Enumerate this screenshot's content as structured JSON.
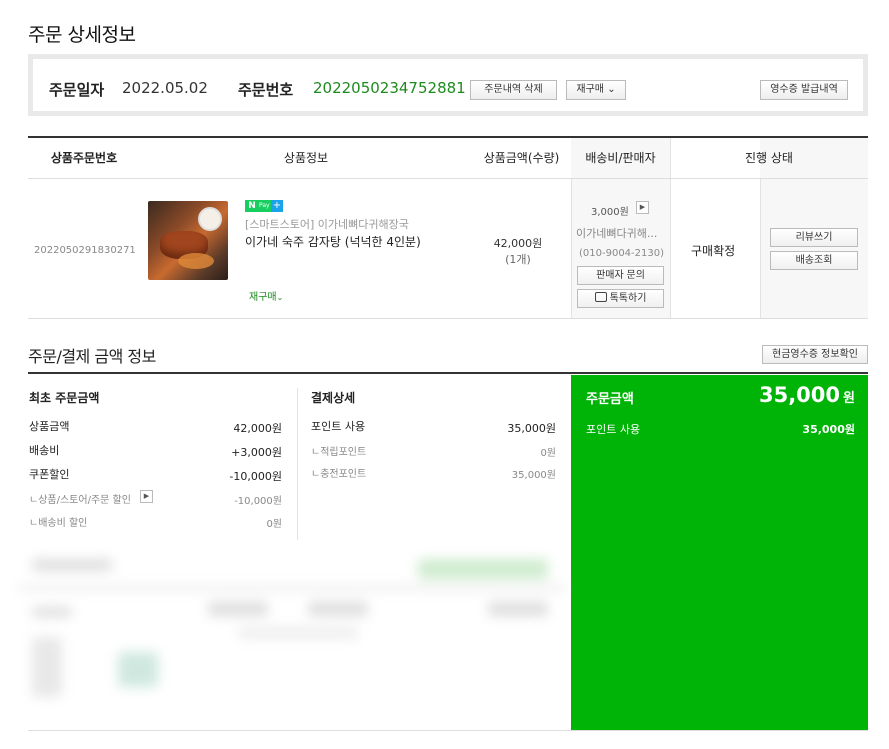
{
  "page": {
    "title": "주문 상세정보"
  },
  "summary": {
    "date_label": "주문일자",
    "date_value": "2022.05.02",
    "number_label": "주문번호",
    "number_value": "2022050234752881",
    "delete_btn": "주문내역 삭제",
    "rebuy_btn": "재구매",
    "receipt_btn": "영수증 발급내역"
  },
  "table": {
    "headers": [
      "상품주문번호",
      "상품정보",
      "상품금액(수량)",
      "배송비/판매자",
      "진행 상태"
    ],
    "row": {
      "order_no": "2022050291830271",
      "badge_n": "N",
      "badge_pay": "Pay",
      "badge_plus": "+",
      "store": "[스마트스토어] 이가네뼈다귀해장국",
      "product": "이가네 숙주 감자탕 (넉넉한 4인분)",
      "rebuy": "재구매",
      "price": "42,000원",
      "qty": "(1개)",
      "ship_fee": "3,000원",
      "seller": "이가네뼈다귀해...",
      "seller_tel": "(010-9004-2130)",
      "inquiry_btn": "판매자 문의",
      "talk_btn": "톡톡하기",
      "status": "구매확정",
      "review_btn": "리뷰쓰기",
      "track_btn": "배송조회"
    }
  },
  "payment": {
    "title": "주문/결제 금액 정보",
    "cash_receipt_btn": "현금영수증 정보확인",
    "initial": {
      "heading": "최초 주문금액",
      "rows": [
        {
          "label": "상품금액",
          "value": "42,000원"
        },
        {
          "label": "배송비",
          "value": "+3,000원"
        },
        {
          "label": "쿠폰할인",
          "value": "-10,000원"
        }
      ],
      "sub_rows": [
        {
          "label": "ㄴ상품/스토어/주문 할인",
          "value": "-10,000원"
        },
        {
          "label": "ㄴ배송비 할인",
          "value": "0원"
        }
      ]
    },
    "detail": {
      "heading": "결제상세",
      "rows": [
        {
          "label": "포인트 사용",
          "value": "35,000원"
        }
      ],
      "sub_rows": [
        {
          "label": "ㄴ적립포인트",
          "value": "0원"
        },
        {
          "label": "ㄴ충전포인트",
          "value": "35,000원"
        }
      ]
    },
    "total": {
      "label": "주문금액",
      "amount": "35,000",
      "unit": "원",
      "sub_label": "포인트 사용",
      "sub_value": "35,000원"
    }
  },
  "colors": {
    "green": "#00b407",
    "accent_text": "#1e8a1e"
  }
}
